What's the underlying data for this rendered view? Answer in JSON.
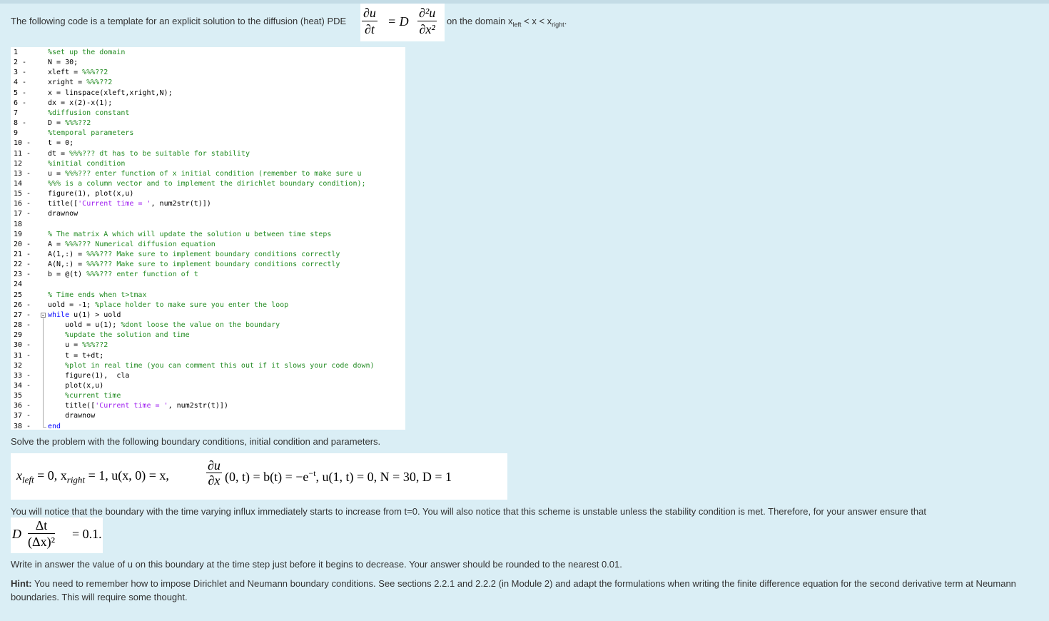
{
  "intro": {
    "before": "The following code is a template for an explicit solution to the diffusion (heat) PDE",
    "after_prefix": "on the domain x",
    "sub_left": "left",
    "mid": " < x < x",
    "sub_right": "right",
    "end": "."
  },
  "pde": {
    "lhs_num": "∂u",
    "lhs_den": "∂t",
    "equals": "= D",
    "rhs_num": "∂²u",
    "rhs_den": "∂x²"
  },
  "code": {
    "lines": [
      {
        "n": "1",
        "t": "%set up the domain"
      },
      {
        "n": "2 -",
        "t": "N = 30;"
      },
      {
        "n": "3 -",
        "t": "xleft = %%%??2"
      },
      {
        "n": "4 -",
        "t": "xright = %%%??2"
      },
      {
        "n": "5 -",
        "t": "x = linspace(xleft,xright,N);"
      },
      {
        "n": "6 -",
        "t": "dx = x(2)-x(1);"
      },
      {
        "n": "7",
        "t": "%diffusion constant"
      },
      {
        "n": "8 -",
        "t": "D = %%%??2"
      },
      {
        "n": "9",
        "t": "%temporal parameters"
      },
      {
        "n": "10 -",
        "t": "t = 0;"
      },
      {
        "n": "11 -",
        "t": "dt = %%%??? dt has to be suitable for stability"
      },
      {
        "n": "12",
        "t": "%initial condition"
      },
      {
        "n": "13 -",
        "t": "u = %%%??? enter function of x initial condition (remember to make sure u"
      },
      {
        "n": "14",
        "t": "%%% is a column vector and to implement the dirichlet boundary condition);"
      },
      {
        "n": "15 -",
        "t": "figure(1), plot(x,u)"
      },
      {
        "n": "16 -",
        "t": "title(['Current time = ', num2str(t)])"
      },
      {
        "n": "17 -",
        "t": "drawnow"
      },
      {
        "n": "18",
        "t": ""
      },
      {
        "n": "19",
        "t": "% The matrix A which will update the solution u between time steps"
      },
      {
        "n": "20 -",
        "t": "A = %%%??? Numerical diffusion equation"
      },
      {
        "n": "21 -",
        "t": "A(1,:) = %%%??? Make sure to implement boundary conditions correctly"
      },
      {
        "n": "22 -",
        "t": "A(N,:) = %%%??? Make sure to implement boundary conditions correctly"
      },
      {
        "n": "23 -",
        "t": "b = @(t) %%%??? enter function of t"
      },
      {
        "n": "24",
        "t": ""
      },
      {
        "n": "25",
        "t": "% Time ends when t>tmax"
      },
      {
        "n": "26 -",
        "t": "uold = -1; %place holder to make sure you enter the loop"
      },
      {
        "n": "27 -",
        "t": "while u(1) > uold"
      },
      {
        "n": "28 -",
        "t": "    uold = u(1); %dont loose the value on the boundary"
      },
      {
        "n": "29",
        "t": "    %update the solution and time"
      },
      {
        "n": "30 -",
        "t": "    u = %%%??2"
      },
      {
        "n": "31 -",
        "t": "    t = t+dt;"
      },
      {
        "n": "32",
        "t": "    %plot in real time (you can comment this out if it slows your code down)"
      },
      {
        "n": "33 -",
        "t": "    figure(1),  cla"
      },
      {
        "n": "34 -",
        "t": "    plot(x,u)"
      },
      {
        "n": "35",
        "t": "    %current time"
      },
      {
        "n": "36 -",
        "t": "    title(['Current time = ', num2str(t)])"
      },
      {
        "n": "37 -",
        "t": "    drawnow"
      },
      {
        "n": "38 -",
        "t": "end"
      }
    ]
  },
  "solve_text": "Solve the problem with the following boundary conditions, initial condition and parameters.",
  "bc": {
    "part1": "x",
    "part1_sub": "left",
    "part2": " = 0, x",
    "part2_sub": "right",
    "part3": " = 1, u(x, 0) = x, ",
    "frac_num": "∂u",
    "frac_den": "∂x",
    "part4": "(0, t) = b(t) = −e",
    "part4_sup": "−t",
    "part5": ", u(1, t) = 0, N = 30, D = 1"
  },
  "notice_text": "You will notice that the boundary with the time varying influx immediately starts to increase from t=0.  You will also notice that this scheme is unstable unless the stability condition is met. Therefore, for your answer ensure that",
  "stability": {
    "D": "D",
    "num": "Δt",
    "den": "(Δx)²",
    "rhs": "= 0.1."
  },
  "write_text": "Write in answer the value of u on this boundary at the time step just before it begins to decrease. Your answer should be rounded to the nearest 0.01.",
  "hint": {
    "label": "Hint:",
    "text": " You need to remember how to impose Dirichlet and Neumann boundary conditions. See sections 2.2.1 and 2.2.2 (in Module 2) and adapt the formulations when writing the finite difference equation for the second derivative term at Neumann boundaries. This will require some thought."
  }
}
